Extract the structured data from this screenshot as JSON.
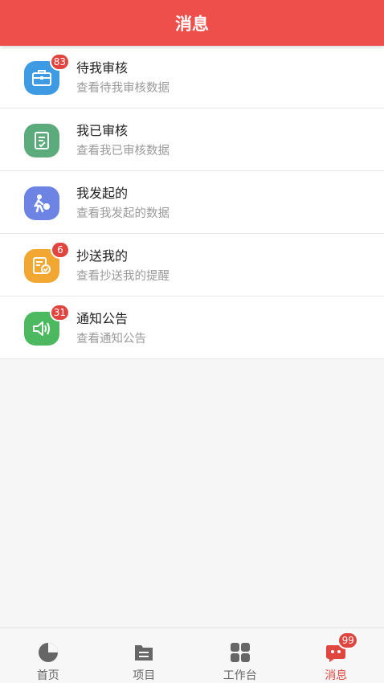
{
  "header": {
    "title": "消息"
  },
  "items": [
    {
      "title": "待我审核",
      "subtitle": "查看待我审核数据",
      "badge": "83",
      "icon": "briefcase-icon",
      "color": "#3e9be3"
    },
    {
      "title": "我已审核",
      "subtitle": "查看我已审核数据",
      "badge": "",
      "icon": "checked-document-icon",
      "color": "#5cab7d"
    },
    {
      "title": "我发起的",
      "subtitle": "查看我发起的数据",
      "badge": "",
      "icon": "person-running-icon",
      "color": "#6e84e4"
    },
    {
      "title": "抄送我的",
      "subtitle": "查看抄送我的提醒",
      "badge": "6",
      "icon": "document-check-icon",
      "color": "#f2a733"
    },
    {
      "title": "通知公告",
      "subtitle": "查看通知公告",
      "badge": "31",
      "icon": "speaker-icon",
      "color": "#4cb85f"
    }
  ],
  "tabbar": {
    "tabs": [
      {
        "label": "首页",
        "icon": "pie-chart-icon"
      },
      {
        "label": "项目",
        "icon": "folder-icon"
      },
      {
        "label": "工作台",
        "icon": "grid-icon"
      },
      {
        "label": "消息",
        "icon": "message-icon",
        "badge": "99",
        "active": true
      }
    ]
  },
  "colors": {
    "accent": "#ef4f4b",
    "badge": "#e0463f"
  }
}
